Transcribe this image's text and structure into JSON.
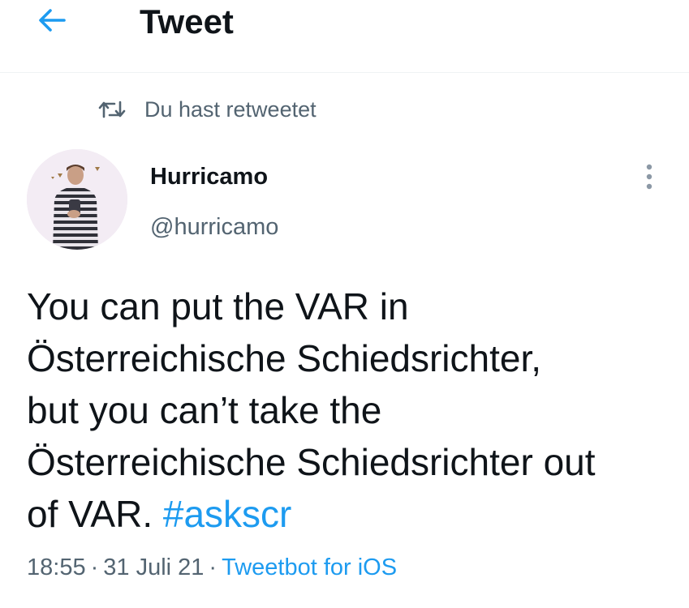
{
  "header": {
    "title": "Tweet"
  },
  "retweet": {
    "label": "Du hast retweetet"
  },
  "author": {
    "name": "Hurricamo",
    "handle": "@hurricamo"
  },
  "tweet": {
    "lines": [
      "You can put the VAR in",
      "Österreichische Schiedsrichter,",
      "but you can’t take the",
      "Österreichische Schiedsrichter out",
      "of VAR."
    ],
    "hashtag": "#askscr"
  },
  "meta": {
    "time": "18:55",
    "separator": "·",
    "date": "31 Juli 21",
    "source": "Tweetbot for iOS"
  },
  "colors": {
    "accent": "#1d9bf0",
    "secondary_text": "#536471",
    "primary_text": "#0f1419"
  },
  "icons": {
    "back": "arrow-left-icon",
    "retweet": "retweet-icon",
    "more": "more-vertical-icon"
  }
}
